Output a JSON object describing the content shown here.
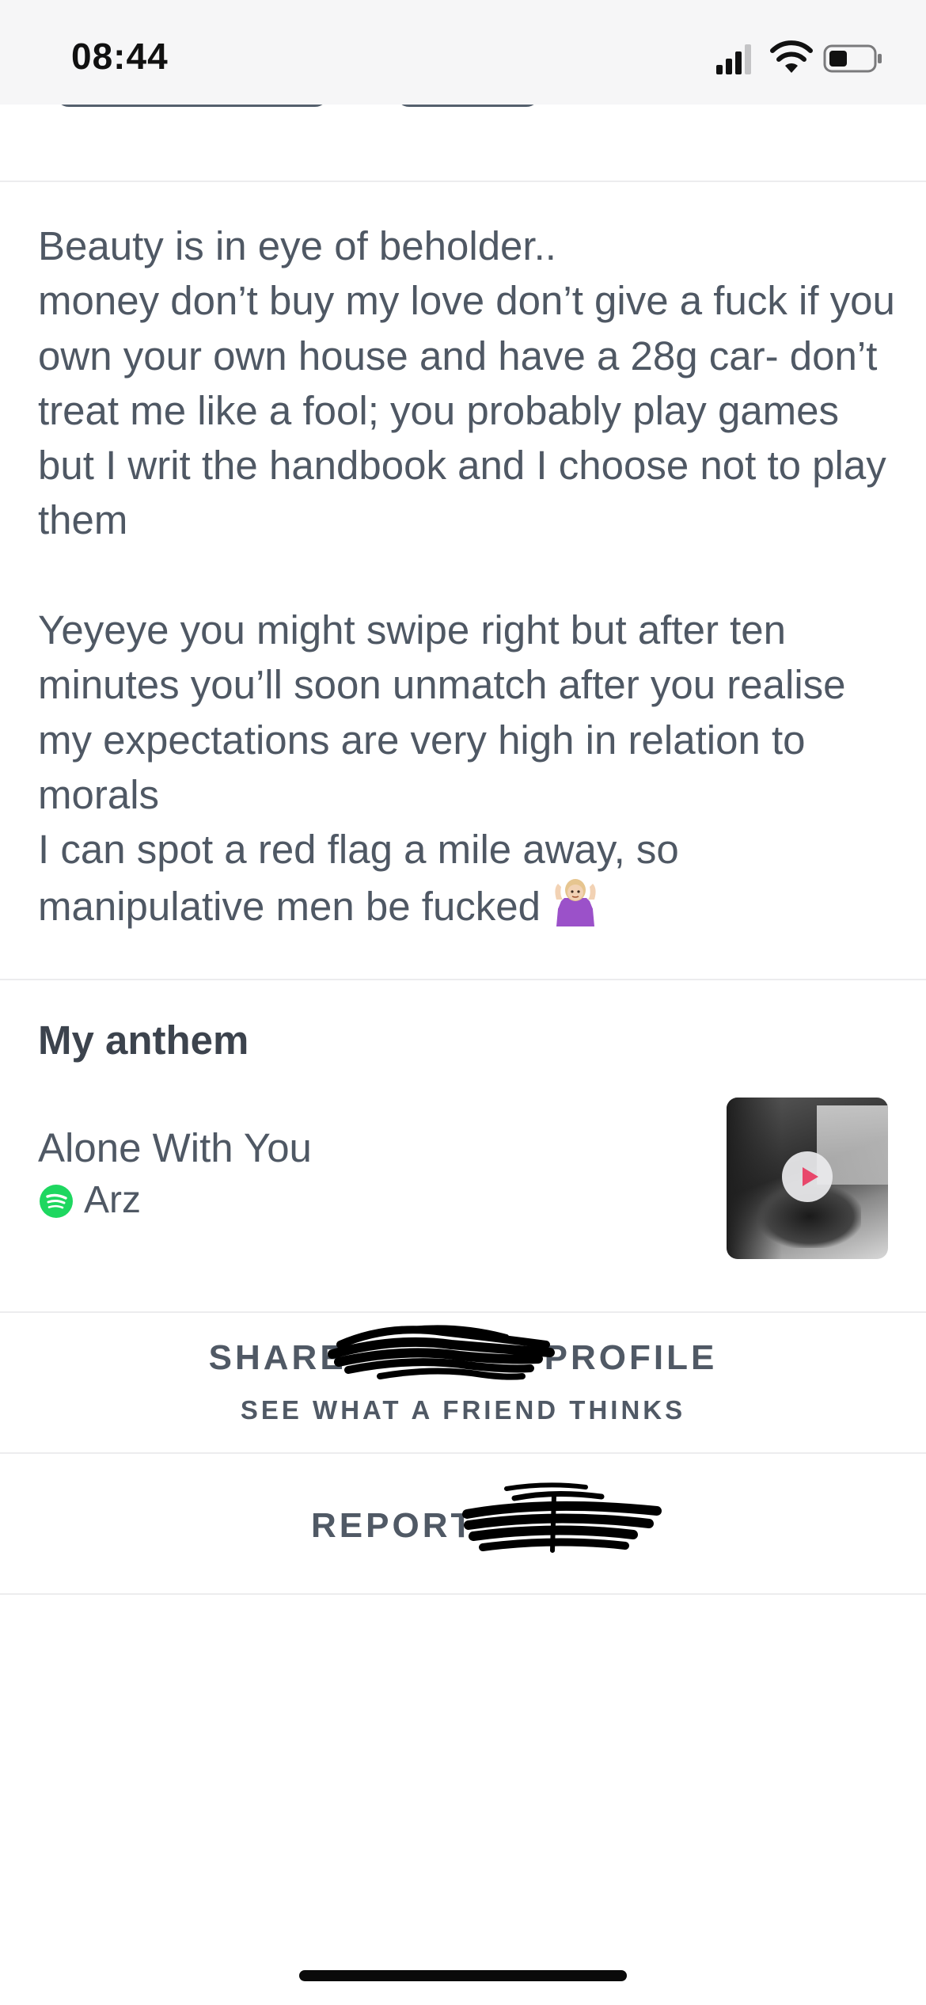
{
  "status_bar": {
    "time": "08:44",
    "icons": [
      "signal-icon",
      "wifi-icon",
      "battery-icon"
    ]
  },
  "bio": {
    "text": "Beauty is in eye of beholder..\nmoney don’t buy my love don’t give a fuck if you own your own house and have a 28g car- don’t treat me like a fool; you probably play games but I writ the handbook and I choose not to play them\n\nYeyeye you might swipe right but after ten minutes you’ll soon unmatch after you realise my expectations are very high in relation to morals\nI can spot a red flag a mile away, so manipulative men be fucked",
    "trailing_emoji": "shrug-emoji"
  },
  "anthem": {
    "section_title": "My anthem",
    "song_title": "Alone With You",
    "artist": "Arz",
    "service_icon": "spotify-icon",
    "play_icon": "play-icon"
  },
  "actions": {
    "share_left": "SHARE",
    "share_right": "PROFILE",
    "share_subtitle": "SEE WHAT A FRIEND THINKS",
    "report_label": "REPORT"
  },
  "colors": {
    "text": "#505965",
    "heading": "#3c434d",
    "divider": "#ececee",
    "spotify_green": "#1ed760",
    "play_accent": "#e8476b"
  }
}
